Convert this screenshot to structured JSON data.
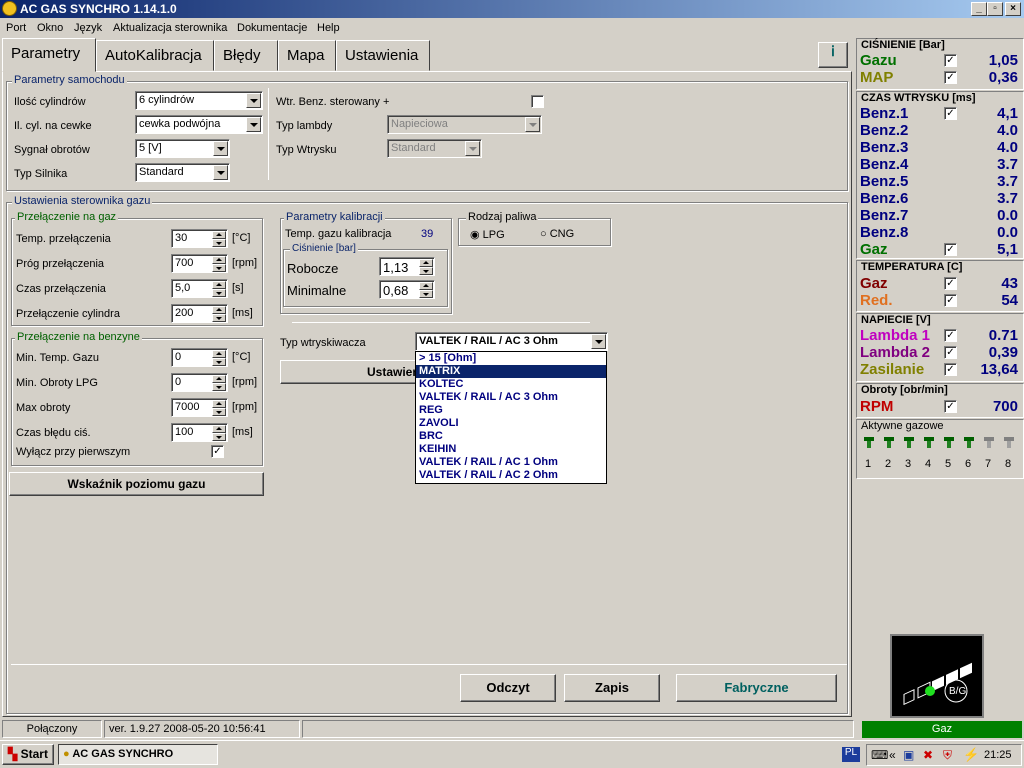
{
  "window": {
    "title": "AC GAS SYNCHRO    1.14.1.0"
  },
  "menu": [
    "Port",
    "Okno",
    "Język",
    "Aktualizacja sterownika",
    "Dokumentacje",
    "Help"
  ],
  "tabs": [
    "Parametry",
    "AutoKalibracja",
    "Błędy",
    "Mapa",
    "Ustawienia"
  ],
  "car": {
    "title": "Parametry samochodu",
    "cylinders_label": "Ilość cylindrów",
    "cylinders": "6 cylindrów",
    "coil_label": "Il. cyl. na cewke",
    "coil": "cewka podwójna",
    "rpm_signal_label": "Sygnał obrotów",
    "rpm_signal": "5 [V]",
    "engine_label": "Typ Silnika",
    "engine": "Standard",
    "petrol_label": "Wtr. Benz. sterowany +",
    "lambda_label": "Typ lambdy",
    "lambda": "Napieciowa",
    "inj_label": "Typ Wtrysku",
    "inj": "Standard"
  },
  "ctrl": {
    "title": "Ustawienia sterownika gazu",
    "gas_switch": {
      "title": "Przełączenie na gaz",
      "rows": [
        {
          "label": "Temp. przełączenia",
          "value": "30",
          "unit": "[°C]"
        },
        {
          "label": "Próg przełączenia",
          "value": "700",
          "unit": "[rpm]"
        },
        {
          "label": "Czas przełączenia",
          "value": "5,0",
          "unit": "[s]"
        },
        {
          "label": "Przełączenie cylindra",
          "value": "200",
          "unit": "[ms]"
        }
      ]
    },
    "petrol_switch": {
      "title": "Przełączenie na benzyne",
      "rows": [
        {
          "label": "Min. Temp. Gazu",
          "value": "0",
          "unit": "[°C]"
        },
        {
          "label": "Min. Obroty LPG",
          "value": "0",
          "unit": "[rpm]"
        },
        {
          "label": "Max obroty",
          "value": "7000",
          "unit": "[rpm]"
        },
        {
          "label": "Czas błędu ciś.",
          "value": "100",
          "unit": "[ms]"
        }
      ],
      "disable_label": "Wyłącz przy pierwszym"
    },
    "gauge_button": "Wskaźnik poziomu gazu",
    "calib": {
      "title": "Parametry kalibracji",
      "temp_label": "Temp. gazu kalibracja",
      "temp": "39",
      "pressure_title": "Ciśnienie [bar]",
      "working_label": "Robocze",
      "working": "1,13",
      "min_label": "Minimalne",
      "min": "0,68"
    },
    "fuel": {
      "title": "Rodzaj paliwa",
      "lpg": "LPG",
      "cng": "CNG"
    },
    "injector_label": "Typ wtryskiwacza",
    "injector": "VALTEK / RAIL / AC 3 Ohm",
    "injector_options": [
      "> 15 [Ohm]",
      "MATRIX",
      "KOLTEC",
      "VALTEK / RAIL / AC 3 Ohm",
      "REG",
      "ZAVOLI",
      "BRC",
      "KEIHIN",
      "VALTEK / RAIL / AC 1 Ohm",
      "VALTEK / RAIL / AC 2 Ohm"
    ],
    "settings_button_partial": "Ustawien"
  },
  "buttons": {
    "read": "Odczyt",
    "save": "Zapis",
    "factory": "Fabryczne"
  },
  "side": {
    "pressure": {
      "title": "CIŚNIENIE [Bar]",
      "rows": [
        {
          "name": "Gazu",
          "value": "1,05",
          "color": "#007000"
        },
        {
          "name": "MAP",
          "value": "0,36",
          "color": "#808000"
        }
      ]
    },
    "inj": {
      "title": "CZAS WTRYSKU  [ms]",
      "rows": [
        {
          "name": "Benz.1",
          "value": "4,1"
        },
        {
          "name": "Benz.2",
          "value": "4.0"
        },
        {
          "name": "Benz.3",
          "value": "4.0"
        },
        {
          "name": "Benz.4",
          "value": "3.7"
        },
        {
          "name": "Benz.5",
          "value": "3.7"
        },
        {
          "name": "Benz.6",
          "value": "3.7"
        },
        {
          "name": "Benz.7",
          "value": "0.0"
        },
        {
          "name": "Benz.8",
          "value": "0.0"
        },
        {
          "name": "Gaz",
          "value": "5,1"
        }
      ]
    },
    "temp": {
      "title": "TEMPERATURA  [C]",
      "rows": [
        {
          "name": "Gaz",
          "value": "43",
          "color": "#800000"
        },
        {
          "name": "Red.",
          "value": "54",
          "color": "#e07020"
        }
      ]
    },
    "volt": {
      "title": "NAPIECIE [V]",
      "rows": [
        {
          "name": "Lambda 1",
          "value": "0.71",
          "color": "#c000c0"
        },
        {
          "name": "Lambda 2",
          "value": "0,39",
          "color": "#800080"
        },
        {
          "name": "Zasilanie",
          "value": "13,64",
          "color": "#808000"
        }
      ]
    },
    "rpm": {
      "title": "Obroty [obr/min]",
      "name": "RPM",
      "value": "700",
      "color": "#c00000"
    },
    "active": {
      "title": "Aktywne gazowe",
      "nums": [
        "1",
        "2",
        "3",
        "4",
        "5",
        "6",
        "7",
        "8"
      ]
    },
    "mode_label": "B/G",
    "fuel_status": "Gaz"
  },
  "status": {
    "conn": "Połączony",
    "ver": "ver. 1.9.27   2008-05-20  10:56:41"
  },
  "taskbar": {
    "start": "Start",
    "app": "AC GAS SYNCHRO",
    "lang": "PL",
    "time": "21:25"
  }
}
